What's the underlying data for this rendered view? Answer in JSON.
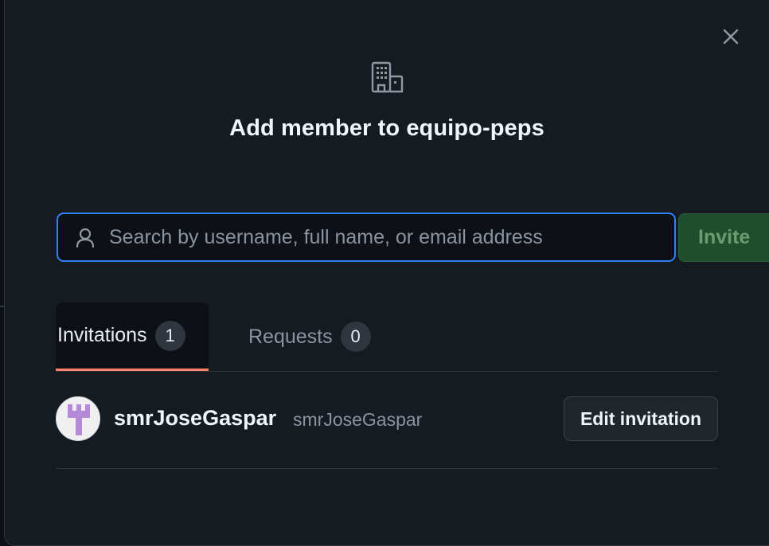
{
  "dialog": {
    "title": "Add member to equipo-peps",
    "close_icon": "x-icon",
    "org_icon": "organization-icon"
  },
  "search": {
    "placeholder": "Search by username, full name, or email address",
    "value": "",
    "icon": "person-icon"
  },
  "invite_button": {
    "label": "Invite"
  },
  "tabs": [
    {
      "label": "Invitations",
      "count": "1",
      "selected": true
    },
    {
      "label": "Requests",
      "count": "0",
      "selected": false
    }
  ],
  "members": [
    {
      "name": "smrJoseGaspar",
      "login": "smrJoseGaspar",
      "action_label": "Edit invitation"
    }
  ],
  "colors": {
    "accent_focus": "#2f81f7",
    "tab_underline": "#f78166",
    "invite_green": "#1f4e2c",
    "avatar_purple": "#b688d9"
  }
}
